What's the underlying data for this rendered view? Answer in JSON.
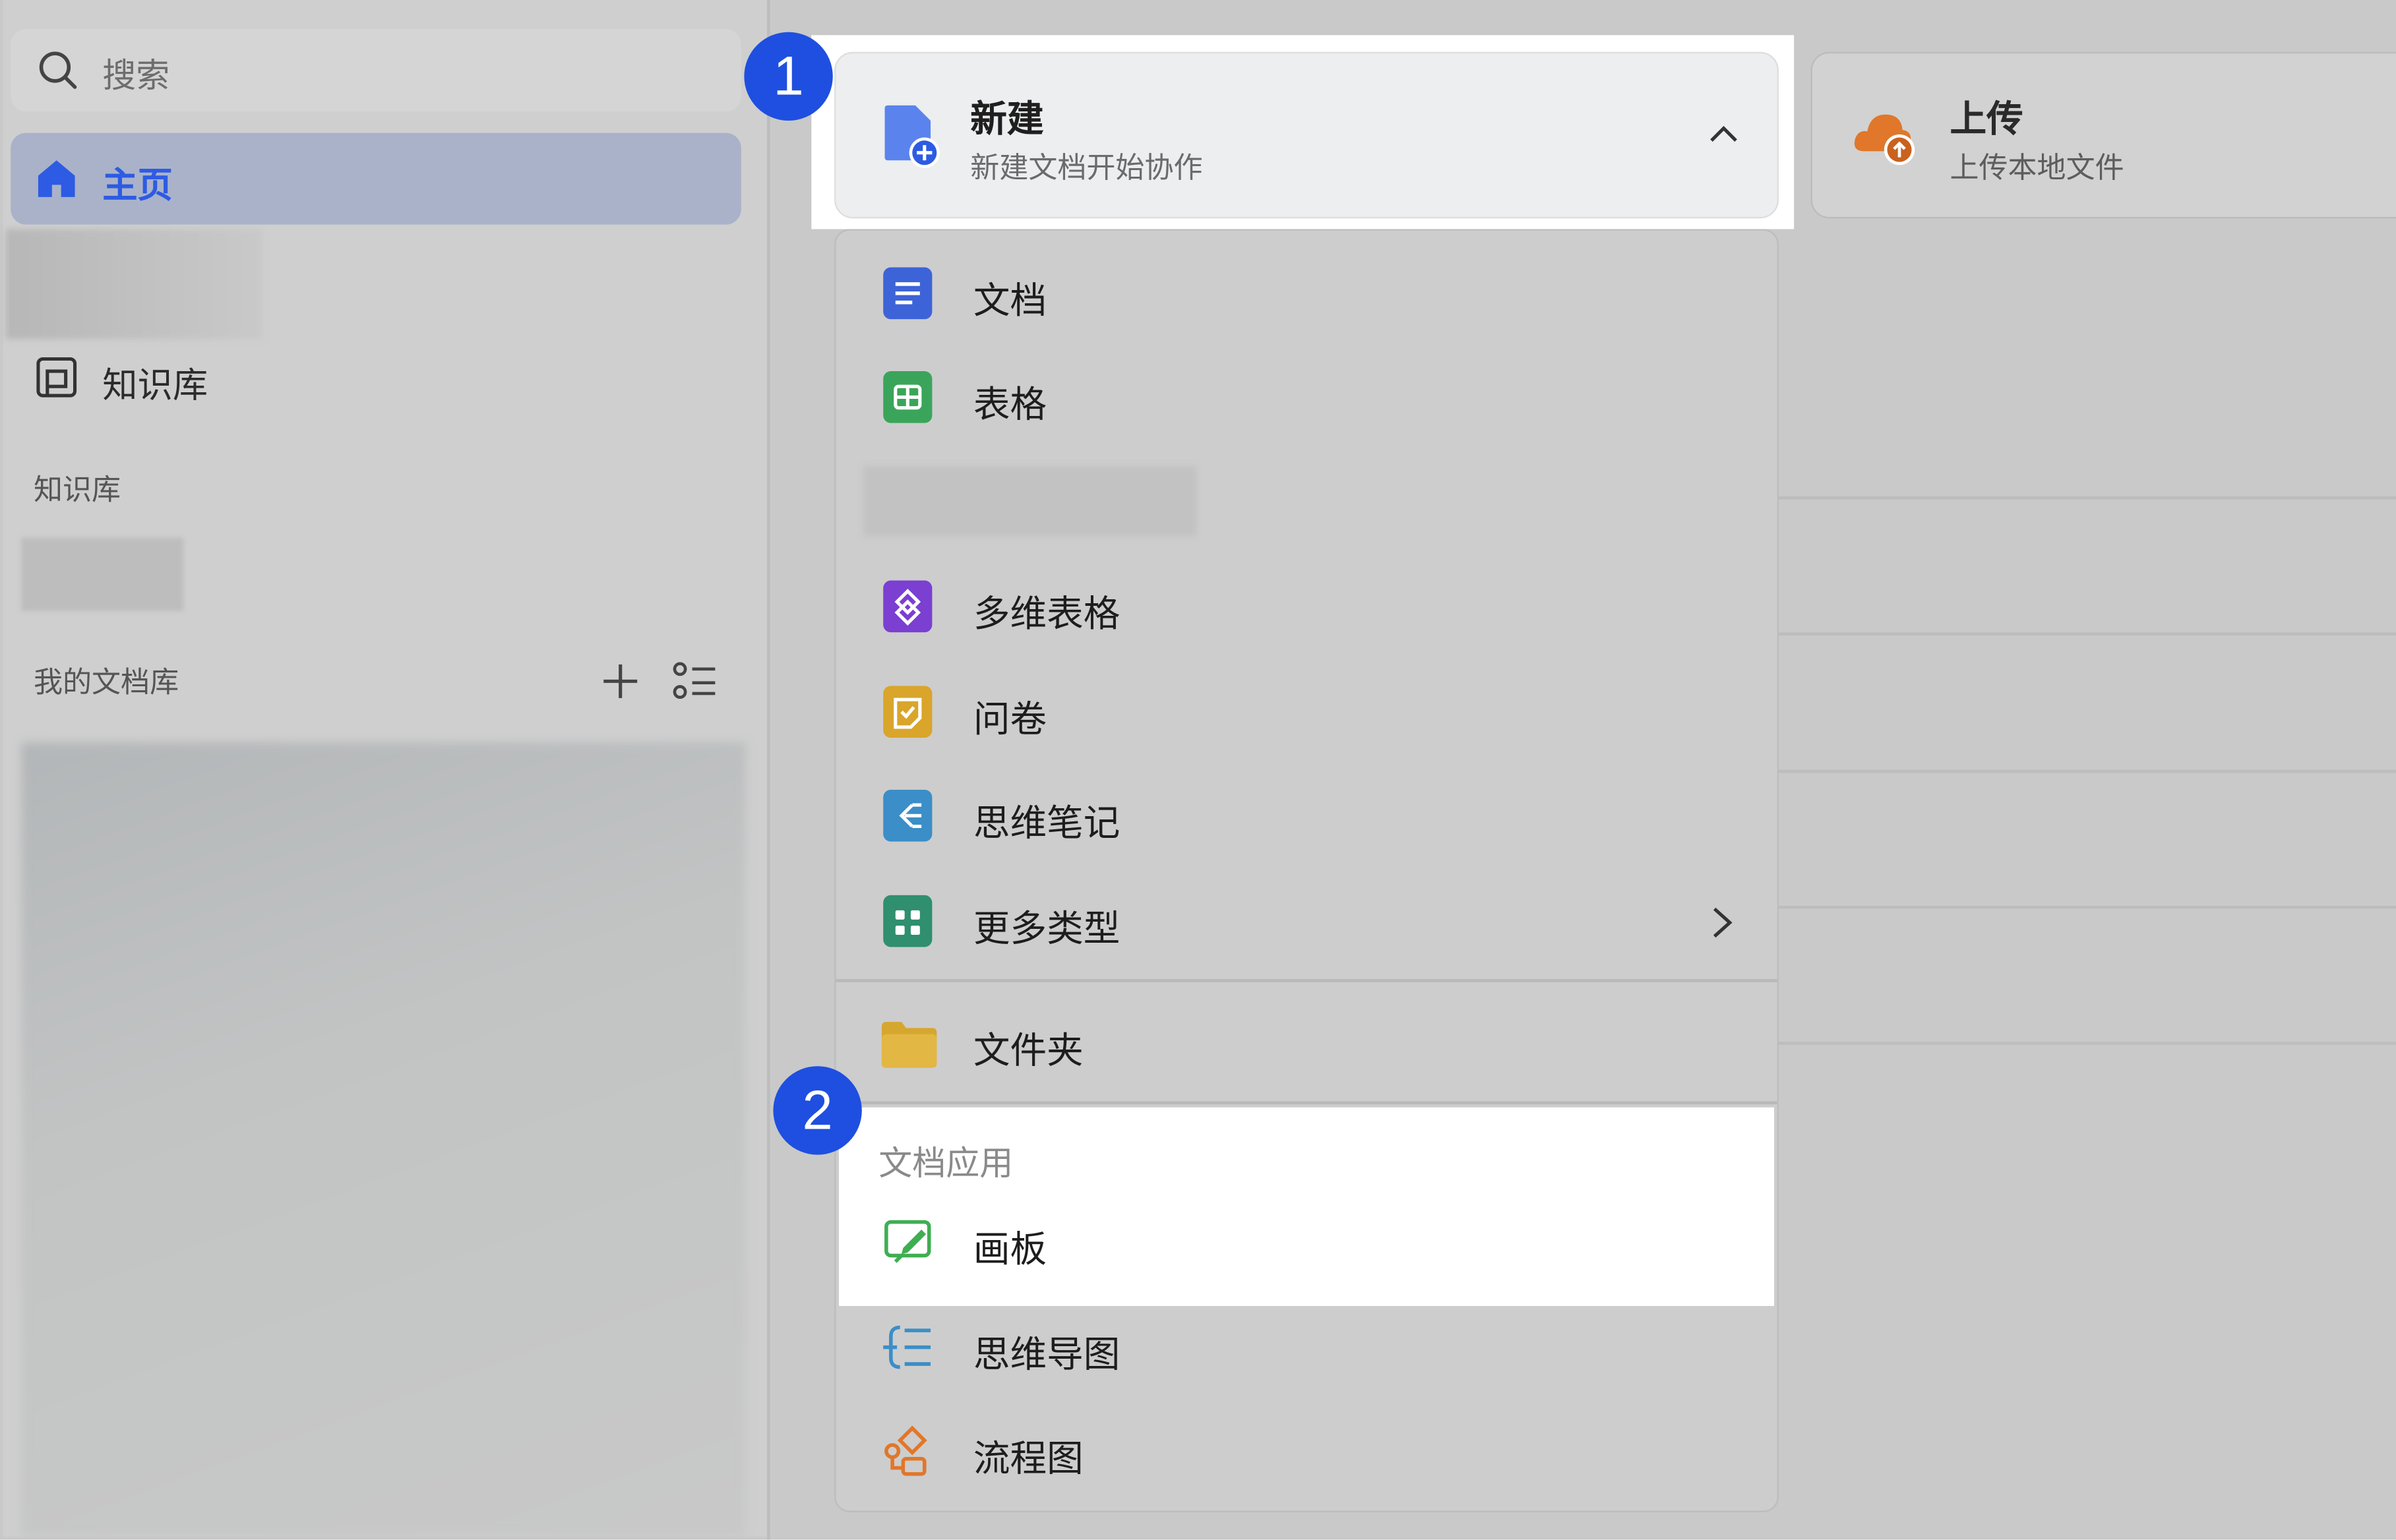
{
  "sidebar": {
    "search_placeholder": "搜索",
    "nav": {
      "home": "主页",
      "knowledge_base": "知识库"
    },
    "sections": {
      "knowledge_base": "知识库",
      "my_docs": "我的文档库"
    }
  },
  "actions": {
    "new": {
      "title": "新建",
      "subtitle": "新建文档开始协作"
    },
    "upload": {
      "title": "上传",
      "subtitle": "上传本地文件"
    }
  },
  "menu": {
    "items": [
      {
        "label": "文档",
        "icon": "doc-icon"
      },
      {
        "label": "表格",
        "icon": "sheet-icon"
      },
      {
        "label": "多维表格",
        "icon": "base-icon"
      },
      {
        "label": "问卷",
        "icon": "survey-icon"
      },
      {
        "label": "思维笔记",
        "icon": "mindnote-icon"
      },
      {
        "label": "更多类型",
        "icon": "more-types-icon"
      },
      {
        "label": "文件夹",
        "icon": "folder-icon"
      }
    ],
    "apps_section_label": "文档应用",
    "apps": [
      {
        "label": "画板",
        "icon": "whiteboard-icon"
      },
      {
        "label": "思维导图",
        "icon": "mindmap-icon"
      },
      {
        "label": "流程图",
        "icon": "flowchart-icon"
      }
    ]
  },
  "badges": {
    "step1": "1",
    "step2": "2"
  },
  "colors": {
    "accent": "#2d5be3",
    "badge": "#1e4fe0",
    "highlight": "#ffffff",
    "overlay_gray": "#c9c9c9"
  }
}
